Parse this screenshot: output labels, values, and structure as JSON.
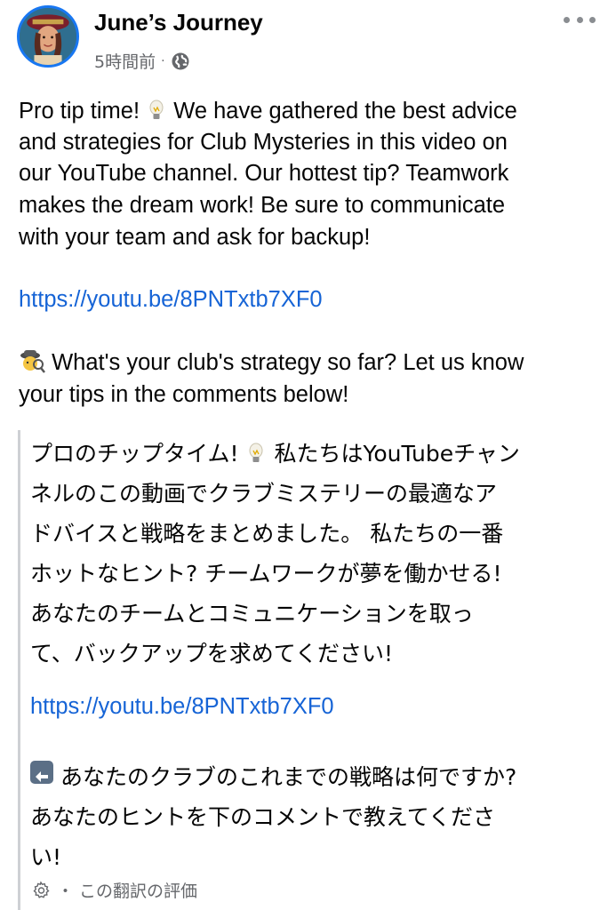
{
  "post": {
    "author": "June’s Journey",
    "time": "5時間前",
    "separator": "·",
    "visibility_icon": "globe-icon",
    "more_icon": "more-options-icon"
  },
  "english": {
    "line1a": "Pro tip time!",
    "line1b": "We have gathered the best advice",
    "line2": "and strategies for Club Mysteries in this video on",
    "line3": "our YouTube channel. Our hottest tip? Teamwork",
    "line4": "makes the dream work! Be sure to communicate",
    "line5": "with your team and ask for backup!",
    "link": "https://youtu.be/8PNTxtb7XF0",
    "q_line1": "What's your club's strategy so far? Let us know",
    "q_line2": "your tips in the comments below!",
    "emoji_tip": "light-bulb-icon",
    "emoji_detective": "detective-icon"
  },
  "translation": {
    "l1a": "プロのチップタイム!",
    "l1b": "私たちはYouTubeチャン",
    "l2": "ネルのこの動画でクラブミステリーの最適なア",
    "l3": "ドバイスと戦略をまとめました。 私たちの一番",
    "l4": "ホットなヒント? チームワークが夢を働かせる!",
    "l5": "あなたのチームとコミュニケーションを取っ",
    "l6": "て、バックアップを求めてください!",
    "link": "https://youtu.be/8PNTxtb7XF0",
    "q1": "あなたのクラブのこれまでの戦略は何ですか?",
    "q2": "あなたのヒントを下のコメントで教えてくださ",
    "q3": "い!",
    "back_icon": "back-arrow-icon",
    "rate_separator": "・",
    "rate_label": "この翻訳の評価",
    "rate_icon": "gear-icon"
  },
  "colors": {
    "link": "#1664d6",
    "avatar_border": "#1877f2",
    "muted_text": "#65676b"
  }
}
